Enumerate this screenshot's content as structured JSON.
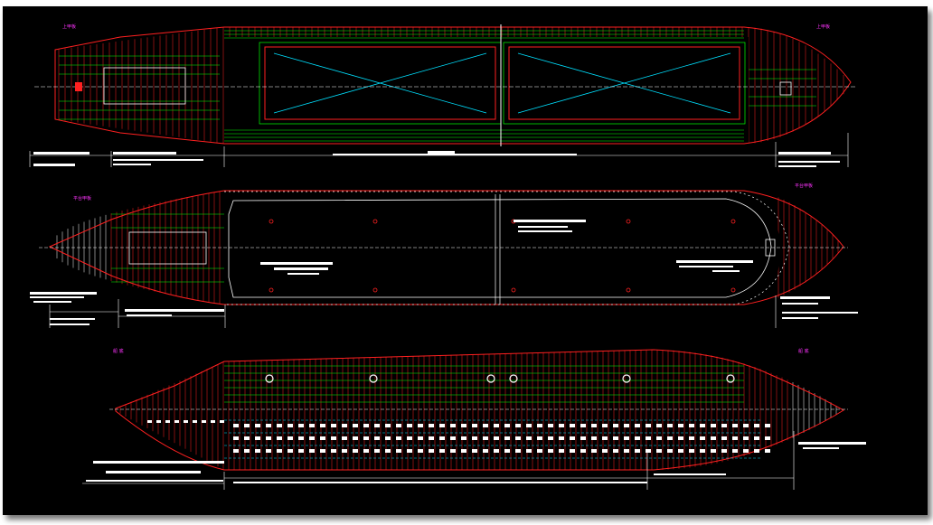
{
  "window": {
    "title": ""
  },
  "drawing": {
    "background": "#000000",
    "colors": {
      "hull": "#ff2020",
      "frames": "#ff2020",
      "longitudinals": "#00ff00",
      "centerline": "#ffffff",
      "diagonals": "#00e0ff",
      "dimensions": "#ffffff",
      "labels": "#ff33ff"
    },
    "views": [
      {
        "name": "upper-deck-plan",
        "label": "上甲板"
      },
      {
        "name": "tween-deck-plan",
        "label": "平台甲板"
      },
      {
        "name": "bottom-plan",
        "label": "船 底"
      }
    ]
  }
}
